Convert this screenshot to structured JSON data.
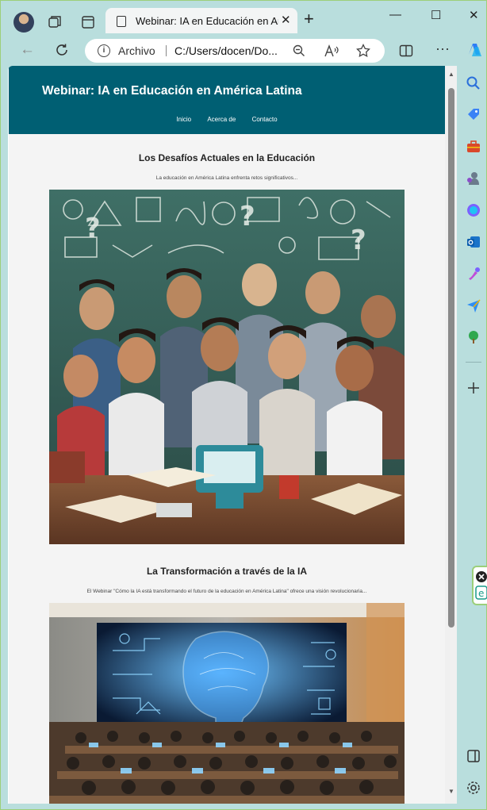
{
  "browser": {
    "tab_title": "Webinar: IA en Educación en Amé",
    "tab_close": "✕",
    "new_tab": "+",
    "window_controls": {
      "minimize": "—",
      "maximize": "☐",
      "close": "✕"
    },
    "address": {
      "label": "Archivo",
      "url": "C:/Users/docen/Do..."
    },
    "sidebar_icons": [
      "search-icon",
      "shopping-tag-icon",
      "toolbox-icon",
      "games-icon",
      "copilot-icon",
      "outlook-icon",
      "designer-icon",
      "send-icon",
      "tree-icon",
      "add-icon",
      "panel-icon",
      "settings-icon"
    ]
  },
  "site": {
    "title": "Webinar: IA en Educación en América Latina",
    "nav": [
      "Inicio",
      "Acerca de",
      "Contacto"
    ]
  },
  "sections": [
    {
      "title": "Los Desafíos Actuales en la Educación",
      "text": "La educación en América Latina enfrenta retos significativos..."
    },
    {
      "title": "La Transformación a través de la IA",
      "text": "El Webinar \"Cómo la IA está transformando el futuro de la educación en América Latina\" ofrece una visión revolucionaria..."
    }
  ],
  "colors": {
    "header": "#005f73",
    "page_bg": "#f4f4f4",
    "browser_frame": "#b9dedd"
  }
}
